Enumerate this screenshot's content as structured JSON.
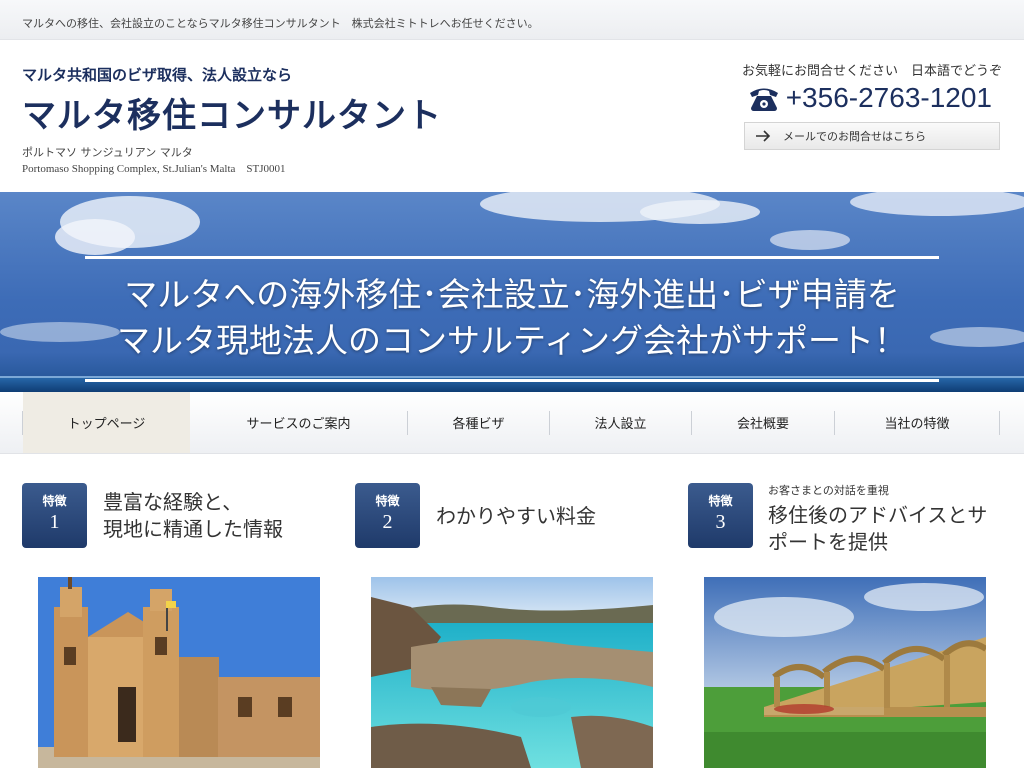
{
  "topbar": {
    "text": "マルタへの移住、会社設立のことならマルタ移住コンサルタント　株式会社ミトトレへお任せください。"
  },
  "header": {
    "tagline": "マルタ共和国のビザ取得、法人設立なら",
    "title": "マルタ移住コンサルタント",
    "address_line1": "ポルトマソ サンジュリアン マルタ",
    "address_line2": "Portomaso Shopping Complex, St.Julian's Malta　STJ0001",
    "contact_note": "お気軽にお問合せください　日本語でどうぞ",
    "phone": "+356-2763-1201",
    "mail_button": "メールでのお問合せはこちら"
  },
  "hero": {
    "line1": "マルタへの海外移住･会社設立･海外進出･ビザ申請を",
    "line2": "マルタ現地法人のコンサルティング会社がサポート！"
  },
  "nav": {
    "items": [
      {
        "label": "トップページ"
      },
      {
        "label": "サービスのご案内"
      },
      {
        "label": "各種ビザ"
      },
      {
        "label": "法人設立"
      },
      {
        "label": "会社概要"
      },
      {
        "label": "当社の特徴"
      }
    ]
  },
  "features": [
    {
      "badge_label": "特徴",
      "badge_num": "1",
      "title_line1": "豊富な経験と、",
      "title_line2": "現地に精通した情報",
      "subtitle": ""
    },
    {
      "badge_label": "特徴",
      "badge_num": "2",
      "title_line1": "わかりやすい料金",
      "title_line2": "",
      "subtitle": ""
    },
    {
      "badge_label": "特徴",
      "badge_num": "3",
      "title_line1": "移住後のアドバイスとサ",
      "title_line2": "ポートを提供",
      "subtitle": "お客さまとの対話を重視"
    }
  ],
  "colors": {
    "brand_navy": "#1c2f5e",
    "badge_blue": "#2b4a7c",
    "nav_active": "#efece4"
  }
}
